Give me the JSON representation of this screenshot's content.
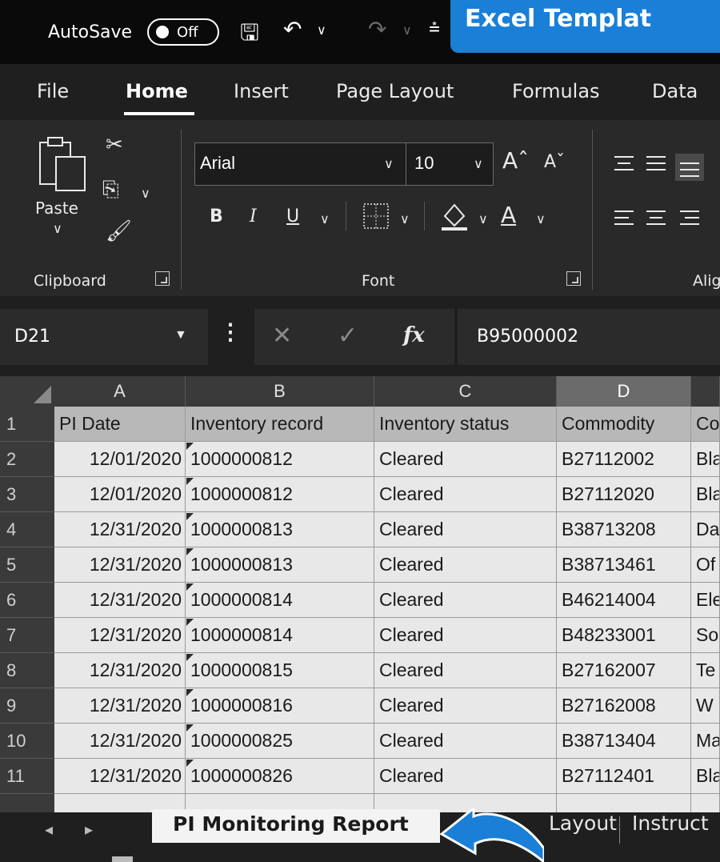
{
  "titlebar": {
    "autosave_label": "AutoSave",
    "autosave_state": "Off",
    "icons": [
      "save-icon",
      "undo-icon",
      "redo-icon",
      "quick-access-dropdown-icon"
    ]
  },
  "banner": {
    "text": "Excel Templat"
  },
  "tabs": [
    {
      "label": "File"
    },
    {
      "label": "Home",
      "active": true
    },
    {
      "label": "Insert"
    },
    {
      "label": "Page Layout"
    },
    {
      "label": "Formulas"
    },
    {
      "label": "Data"
    }
  ],
  "ribbon": {
    "clipboard": {
      "paste_label": "Paste",
      "group_label": "Clipboard"
    },
    "font": {
      "name": "Arial",
      "size": "10",
      "group_label": "Font",
      "bold": "B",
      "italic": "I",
      "underline": "U",
      "increase": "Aˆ",
      "decrease": "Aˇ",
      "fontcolor_letter": "A"
    },
    "alignment": {
      "group_label": "Alig"
    }
  },
  "formula_bar": {
    "name_box": "D21",
    "fx": "fx",
    "value": "B95000002"
  },
  "grid": {
    "columns": [
      "A",
      "B",
      "C",
      "D"
    ],
    "selected_column": "D",
    "header_row": [
      "PI Date",
      "Inventory record",
      "Inventory status",
      "Commodity",
      "Co"
    ],
    "rows": [
      {
        "n": "1"
      },
      {
        "n": "2",
        "a": "12/01/2020",
        "b": "1000000812",
        "c": "Cleared",
        "d": "B27112002",
        "e": "Bla"
      },
      {
        "n": "3",
        "a": "12/01/2020",
        "b": "1000000812",
        "c": "Cleared",
        "d": "B27112020",
        "e": "Bla"
      },
      {
        "n": "4",
        "a": "12/31/2020",
        "b": "1000000813",
        "c": "Cleared",
        "d": "B38713208",
        "e": "Da"
      },
      {
        "n": "5",
        "a": "12/31/2020",
        "b": "1000000813",
        "c": "Cleared",
        "d": "B38713461",
        "e": "Of"
      },
      {
        "n": "6",
        "a": "12/31/2020",
        "b": "1000000814",
        "c": "Cleared",
        "d": "B46214004",
        "e": "Ele"
      },
      {
        "n": "7",
        "a": "12/31/2020",
        "b": "1000000814",
        "c": "Cleared",
        "d": "B48233001",
        "e": "So"
      },
      {
        "n": "8",
        "a": "12/31/2020",
        "b": "1000000815",
        "c": "Cleared",
        "d": "B27162007",
        "e": "Te"
      },
      {
        "n": "9",
        "a": "12/31/2020",
        "b": "1000000816",
        "c": "Cleared",
        "d": "B27162008",
        "e": "W"
      },
      {
        "n": "10",
        "a": "12/31/2020",
        "b": "1000000825",
        "c": "Cleared",
        "d": "B38713404",
        "e": "Ma"
      },
      {
        "n": "11",
        "a": "12/31/2020",
        "b": "1000000826",
        "c": "Cleared",
        "d": "B27112401",
        "e": "Bla"
      }
    ]
  },
  "sheets": {
    "active": "PI Monitoring Report",
    "others": [
      "Layout",
      "Instruct"
    ]
  },
  "colors": {
    "banner": "#1a7fd6",
    "arrow": "#1a7fd6"
  }
}
